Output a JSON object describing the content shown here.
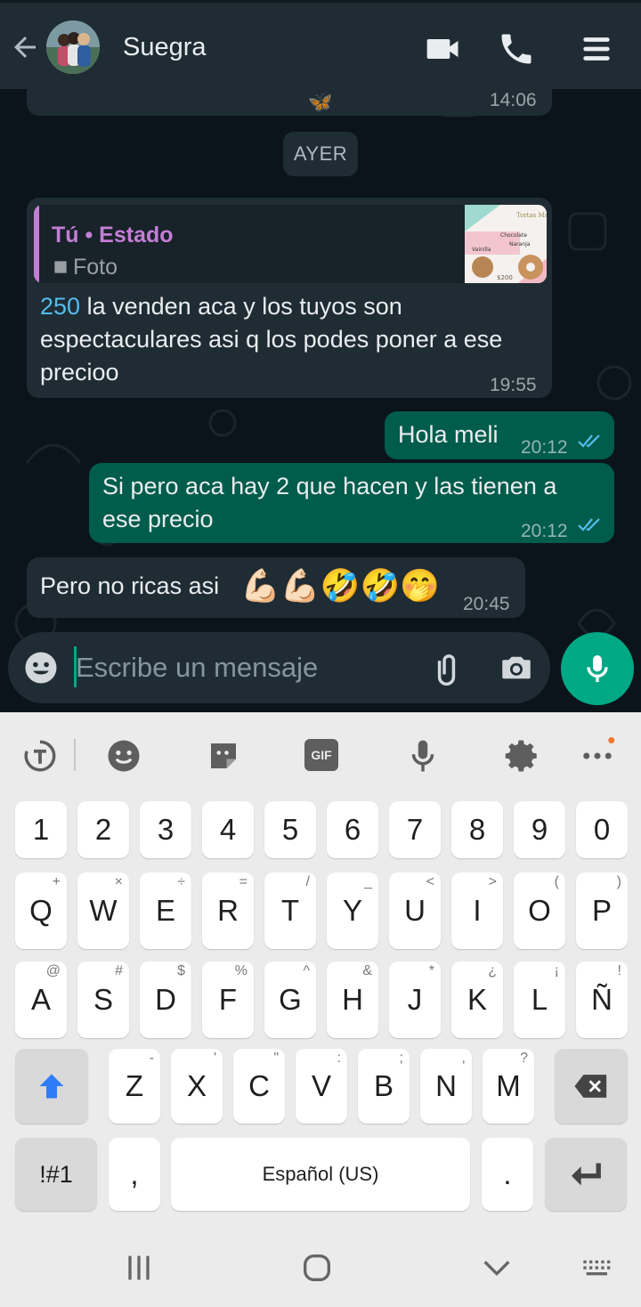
{
  "header": {
    "contact_name": "Suegra",
    "icons": [
      "back-arrow-icon",
      "video-call-icon",
      "voice-call-icon",
      "menu-icon"
    ]
  },
  "chat": {
    "prev_message": {
      "emoji": "🦋",
      "time": "14:06"
    },
    "date_chip": "AYER",
    "reply_message": {
      "quote_author": "Tú • Estado",
      "quote_type": "Foto",
      "quote_thumb_texts": {
        "title": "Tortas Materas",
        "items": [
          "Chocolate",
          "Vainilla",
          "Naranja"
        ],
        "price": "$200"
      },
      "highlight": "250",
      "text": " la venden aca y los tuyos son espectaculares asi q los podes poner a ese precioo",
      "time": "19:55"
    },
    "messages": [
      {
        "direction": "out",
        "text": "Hola meli",
        "time": "20:12",
        "status": "read"
      },
      {
        "direction": "out",
        "text": "Si pero aca hay 2 que hacen y las tienen a ese precio",
        "time": "20:12",
        "status": "read"
      },
      {
        "direction": "in",
        "text": "Pero no ricas asi",
        "emojis": "💪🏻💪🏻🤣🤣🤭",
        "time": "20:45"
      }
    ]
  },
  "composer": {
    "placeholder": "Escribe un mensaje",
    "icons": [
      "emoji-icon",
      "attach-icon",
      "camera-icon",
      "mic-icon"
    ]
  },
  "keyboard": {
    "number_row": [
      "1",
      "2",
      "3",
      "4",
      "5",
      "6",
      "7",
      "8",
      "9",
      "0"
    ],
    "row1": [
      [
        "Q",
        "+"
      ],
      [
        "W",
        "×"
      ],
      [
        "E",
        "÷"
      ],
      [
        "R",
        "="
      ],
      [
        "T",
        "/"
      ],
      [
        "Y",
        "_"
      ],
      [
        "U",
        "<"
      ],
      [
        "I",
        ">"
      ],
      [
        "O",
        "("
      ],
      [
        "P",
        ")"
      ]
    ],
    "row2": [
      [
        "A",
        "@"
      ],
      [
        "S",
        "#"
      ],
      [
        "D",
        "$"
      ],
      [
        "F",
        "%"
      ],
      [
        "G",
        "^"
      ],
      [
        "H",
        "&"
      ],
      [
        "J",
        "*"
      ],
      [
        "K",
        "¿"
      ],
      [
        "L",
        "¡"
      ],
      [
        "Ñ",
        "!"
      ]
    ],
    "row3": [
      [
        "Z",
        "-"
      ],
      [
        "X",
        "'"
      ],
      [
        "C",
        "\""
      ],
      [
        "V",
        ":"
      ],
      [
        "B",
        ";"
      ],
      [
        "N",
        ","
      ],
      [
        "M",
        "?"
      ]
    ],
    "symbols_key": "!#1",
    "comma_key": ",",
    "space_label": "Español (US)",
    "period_key": ".",
    "toolbar_gif": "GIF"
  },
  "colors": {
    "accent": "#00a884",
    "outgoing": "#005c4b",
    "incoming": "#1f2c34",
    "read_ticks": "#53bdeb"
  }
}
